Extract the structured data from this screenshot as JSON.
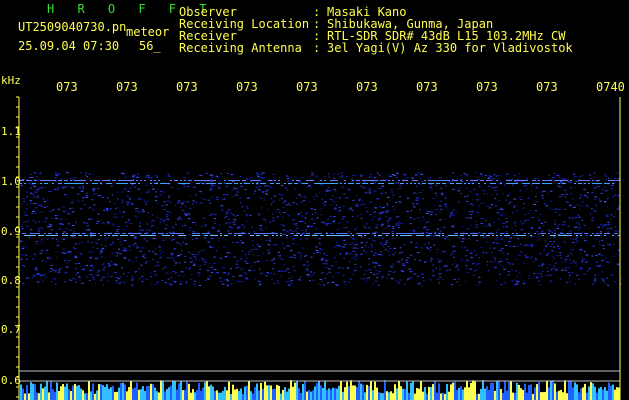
{
  "header": {
    "title": "H R O F F T",
    "filename": "UT2509040730.pn",
    "mode": "meteor",
    "datetime": "25.09.04 07:30",
    "count": "56_"
  },
  "info": [
    {
      "label": "Observer",
      "value": "Masaki Kano"
    },
    {
      "label": "Receiving Location",
      "value": "Shibukawa, Gunma, Japan"
    },
    {
      "label": "Receiver",
      "value": "RTL-SDR SDR# 43dB L15 103.2MHz CW"
    },
    {
      "label": "Receiving Antenna",
      "value": "3el Yagi(V) Az 330 for Vladivostok"
    }
  ],
  "axis": {
    "freq_unit": "kHz",
    "time_ticks": [
      "073",
      "073",
      "073",
      "073",
      "073",
      "073",
      "073",
      "073",
      "073",
      "0740"
    ],
    "freq_ticks": [
      "1.1",
      "1.0",
      "0.9",
      "0.8",
      "0.7",
      "0.6"
    ]
  },
  "colors": {
    "label_yellow": "#ffff50",
    "title_green": "#30e030",
    "signal_blue": "#2030ff",
    "background": "#000000"
  }
}
